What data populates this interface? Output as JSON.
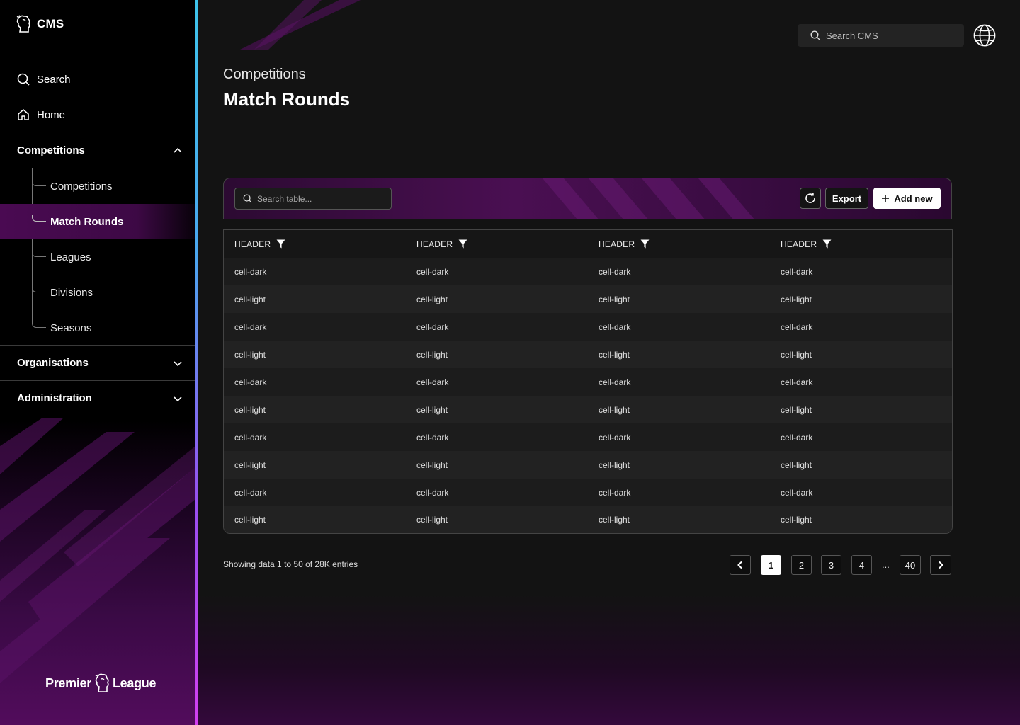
{
  "app": {
    "title": "CMS",
    "brand_name_left": "Premier",
    "brand_name_right": "League"
  },
  "sidebar": {
    "search_label": "Search",
    "home_label": "Home",
    "sections": [
      {
        "label": "Competitions",
        "expanded": true
      },
      {
        "label": "Organisations",
        "expanded": false
      },
      {
        "label": "Administration",
        "expanded": false
      }
    ],
    "sub_items": [
      "Competitions",
      "Match Rounds",
      "Leagues",
      "Divisions",
      "Seasons"
    ],
    "active_sub_item": "Match Rounds"
  },
  "header": {
    "search_placeholder": "Search CMS",
    "breadcrumb": "Competitions",
    "title": "Match Rounds"
  },
  "toolbar": {
    "search_placeholder": "Search table...",
    "export_label": "Export",
    "add_label": "Add new"
  },
  "table": {
    "headers": [
      "HEADER",
      "HEADER",
      "HEADER",
      "HEADER"
    ],
    "rows": [
      [
        "cell-dark",
        "cell-dark",
        "cell-dark",
        "cell-dark"
      ],
      [
        "cell-light",
        "cell-light",
        "cell-light",
        "cell-light"
      ],
      [
        "cell-dark",
        "cell-dark",
        "cell-dark",
        "cell-dark"
      ],
      [
        "cell-light",
        "cell-light",
        "cell-light",
        "cell-light"
      ],
      [
        "cell-dark",
        "cell-dark",
        "cell-dark",
        "cell-dark"
      ],
      [
        "cell-light",
        "cell-light",
        "cell-light",
        "cell-light"
      ],
      [
        "cell-dark",
        "cell-dark",
        "cell-dark",
        "cell-dark"
      ],
      [
        "cell-light",
        "cell-light",
        "cell-light",
        "cell-light"
      ],
      [
        "cell-dark",
        "cell-dark",
        "cell-dark",
        "cell-dark"
      ],
      [
        "cell-light",
        "cell-light",
        "cell-light",
        "cell-light"
      ]
    ]
  },
  "footer": {
    "showing_text": "Showing data 1 to 50 of  28K entries",
    "pages": [
      "1",
      "2",
      "3",
      "4"
    ],
    "ellipsis": "...",
    "last_page": "40",
    "current_page": "1"
  },
  "colors": {
    "accent_purple": "#4a0a52",
    "accent_cyan": "#3ec3ea",
    "accent_magenta": "#d23ff0"
  },
  "icons": [
    "lion-icon",
    "search-icon",
    "home-icon",
    "chevron-up-icon",
    "chevron-down-icon",
    "globe-icon",
    "filter-icon",
    "refresh-icon",
    "plus-icon",
    "chevron-left-icon",
    "chevron-right-icon"
  ]
}
